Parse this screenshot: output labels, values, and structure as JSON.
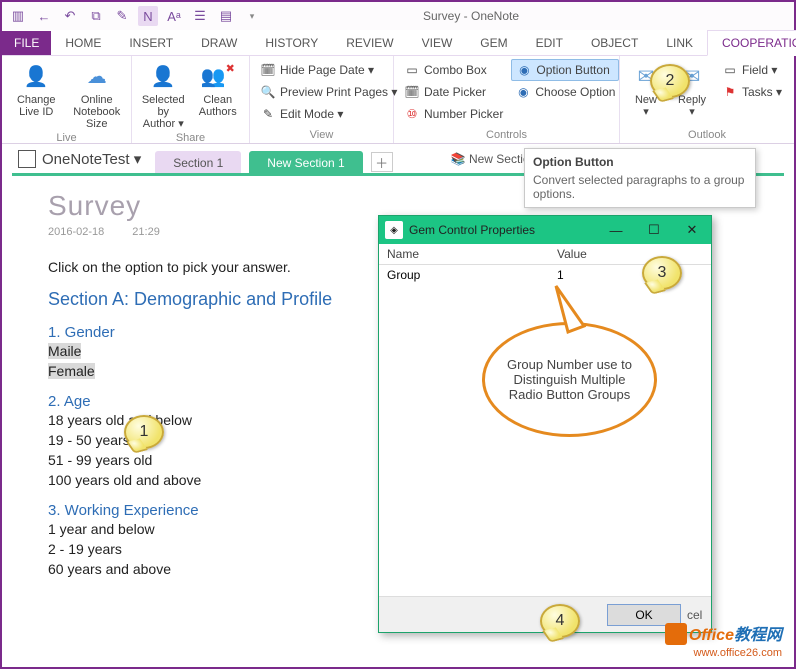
{
  "app": {
    "title": "Survey - OneNote"
  },
  "tabs": {
    "file": "FILE",
    "items": [
      "HOME",
      "INSERT",
      "DRAW",
      "HISTORY",
      "REVIEW",
      "VIEW",
      "GEM",
      "EDIT",
      "OBJECT",
      "LINK",
      "COOPERATION"
    ],
    "active": "COOPERATION"
  },
  "ribbon": {
    "live": {
      "label": "Live",
      "change": "Change\nLive ID",
      "notebook": "Online\nNotebook Size"
    },
    "share": {
      "label": "Share",
      "selected": "Selected by\nAuthor ▾",
      "clean": "Clean\nAuthors"
    },
    "view": {
      "label": "View",
      "hide": "Hide Page Date ▾",
      "preview": "Preview Print Pages ▾",
      "edit": "Edit Mode ▾"
    },
    "controls": {
      "label": "Controls",
      "combo": "Combo Box",
      "date": "Date Picker",
      "number": "Number Picker",
      "option": "Option Button",
      "choose": "Choose Option"
    },
    "outlook": {
      "label": "Outlook",
      "new": "New\n▾",
      "reply": "Reply\n▾",
      "field": "Field ▾",
      "tasks": "Tasks ▾"
    }
  },
  "tooltip": {
    "title": "Option Button",
    "body": "Convert selected paragraphs to a group options."
  },
  "notebook": {
    "name": "OneNoteTest ▾",
    "tabs": [
      "Section 1",
      "New Section 1"
    ],
    "group": "New Section"
  },
  "page": {
    "title": "Survey",
    "date": "2016-02-18",
    "time": "21:29",
    "instruction": "Click on the option to pick your answer.",
    "sectionA": "Section A: Demographic and Profile",
    "q1": {
      "title": "1. Gender",
      "a1": "Maile",
      "a2": "Female"
    },
    "q2": {
      "title": "2. Age",
      "a1": "18 years old and below",
      "a2": "19 - 50 years old",
      "a3": "51 - 99 years old",
      "a4": "100 years old and above"
    },
    "q3": {
      "title": "3. Working Experience",
      "a1": "1 year and below",
      "a2": "2 - 19 years",
      "a3": "60 years and above"
    }
  },
  "dialog": {
    "title": "Gem Control Properties",
    "col_name": "Name",
    "col_value": "Value",
    "row_name": "Group",
    "row_value": "1",
    "ok": "OK",
    "cancel": "cel"
  },
  "callouts": {
    "n1": "1",
    "n2": "2",
    "n3": "3",
    "n4": "4",
    "oval": "Group Number use to Distinguish Multiple Radio Button Groups"
  },
  "watermark": {
    "brand1": "Office",
    "brand2": "教程网",
    "url": "www.office26.com"
  }
}
